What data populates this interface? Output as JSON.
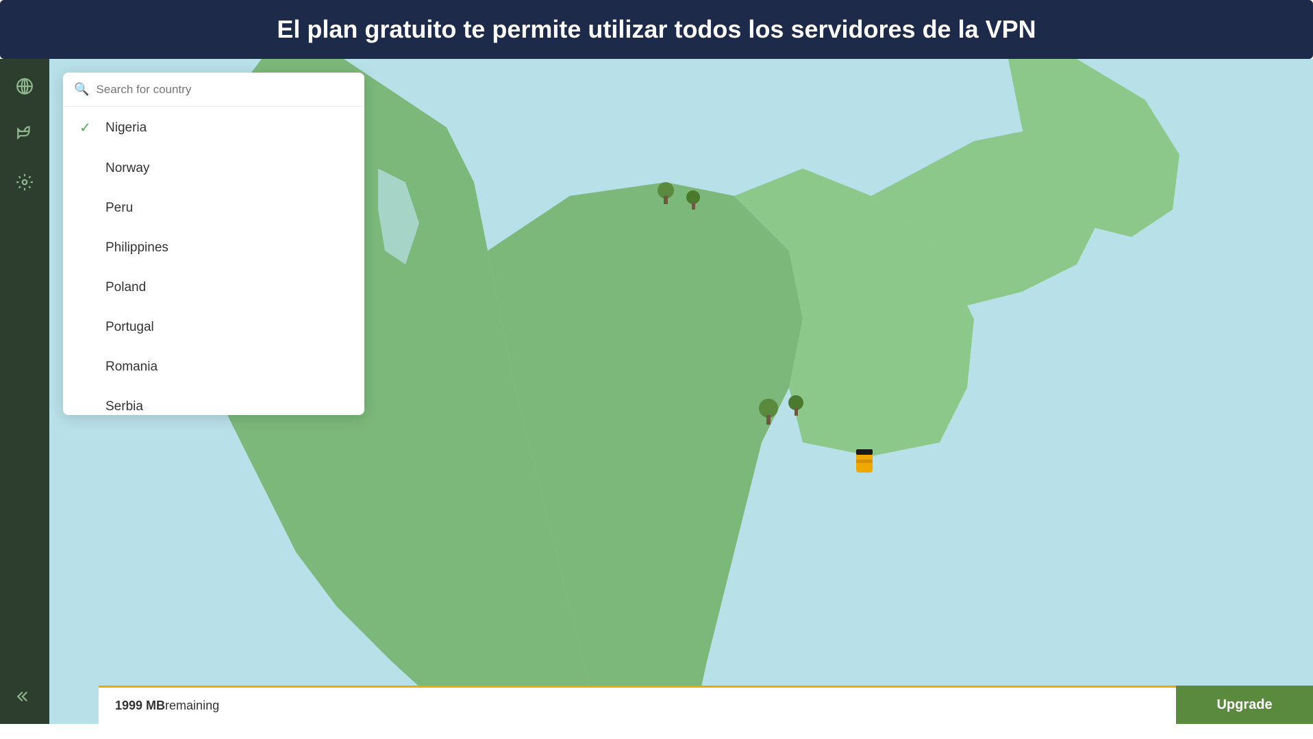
{
  "banner": {
    "text": "El plan gratuito te permite utilizar todos los servidores de la VPN"
  },
  "sidebar": {
    "icons": [
      {
        "name": "globe-icon",
        "label": "Globe"
      },
      {
        "name": "megaphone-icon",
        "label": "Notifications"
      },
      {
        "name": "settings-icon",
        "label": "Settings"
      }
    ],
    "bottom_icons": [
      {
        "name": "collapse-icon",
        "label": "Collapse"
      }
    ]
  },
  "search": {
    "placeholder": "Search for country"
  },
  "countries": [
    {
      "name": "Nigeria",
      "selected": true
    },
    {
      "name": "Norway",
      "selected": false
    },
    {
      "name": "Peru",
      "selected": false
    },
    {
      "name": "Philippines",
      "selected": false
    },
    {
      "name": "Poland",
      "selected": false
    },
    {
      "name": "Portugal",
      "selected": false
    },
    {
      "name": "Romania",
      "selected": false
    },
    {
      "name": "Serbia",
      "selected": false
    }
  ],
  "bottom_bar": {
    "data_label": "1999 MB",
    "data_suffix": " remaining",
    "upgrade_label": "Upgrade"
  },
  "colors": {
    "banner_bg": "#1e2a4a",
    "sidebar_bg": "#2d3e2f",
    "map_water": "#b8e0e8",
    "map_land": "#7cb87a",
    "upgrade_bg": "#5a8a3e",
    "selected_check": "#4caf50",
    "data_bar_color": "#f0a800"
  }
}
